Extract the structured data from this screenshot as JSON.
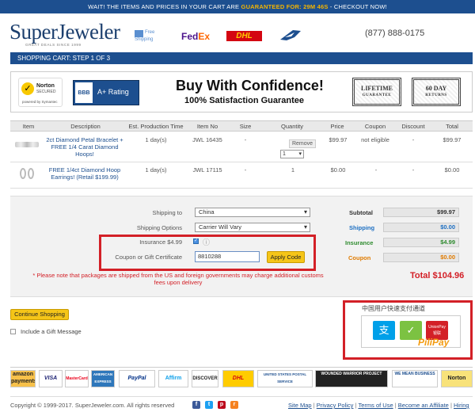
{
  "banner": {
    "prefix": "WAIT! THE ITEMS AND PRICES IN YOUR CART ARE ",
    "highlight": "GUARANTEED FOR: 29M 46S",
    "suffix": " - CHECKOUT NOW!"
  },
  "header": {
    "logo_part1": "Super",
    "logo_part2": "Jeweler",
    "logo_tagline": "GREAT DEALS SINCE 1999",
    "free_shipping": "Free Shipping",
    "fedex_fed": "Fed",
    "fedex_ex": "Ex",
    "dhl": "DHL",
    "phone": "(877) 888-0175"
  },
  "step_title": "SHOPPING CART: STEP 1 OF 3",
  "confidence": {
    "norton_name": "Norton",
    "norton_secured": "SECURED",
    "norton_powered": "powered by Symantec",
    "bbb_seal": "BBB",
    "bbb_rating": "A+ Rating",
    "title": "Buy With Confidence!",
    "subtitle": "100% Satisfaction Guarantee",
    "stamp1_line1": "LIFETIME",
    "stamp1_line2": "GUARANTEE",
    "stamp2_line1": "60 DAY",
    "stamp2_line2": "RETURNS"
  },
  "table": {
    "headers": [
      "Item",
      "Description",
      "Est. Production Time",
      "Item No",
      "Size",
      "Quantity",
      "Price",
      "Coupon",
      "Discount",
      "Total"
    ],
    "rows": [
      {
        "description": "2ct Diamond Petal Bracelet + FREE 1/4 Carat Diamond Hoops!",
        "production": "1 day(s)",
        "item_no": "JWL 16435",
        "size": "-",
        "remove": "Remove",
        "qty": "1",
        "price": "$99.97",
        "coupon": "not eligible",
        "discount": "-",
        "total": "$99.97"
      },
      {
        "description": "FREE 1/4ct Diamond Hoop Earrings! (Retail $199.99)",
        "production": "1 day(s)",
        "item_no": "JWL 17115",
        "size": "-",
        "qty": "1",
        "price": "$0.00",
        "coupon": "-",
        "discount": "-",
        "total": "$0.00"
      }
    ]
  },
  "shipping": {
    "ship_to_label": "Shipping to",
    "ship_to_value": "China",
    "options_label": "Shipping Options",
    "options_value": "Carrier Will Vary",
    "insurance_label": "Insurance $4.99",
    "coupon_label": "Coupon or Gift Certificate",
    "coupon_value": "8810288",
    "apply_label": "Apply Code",
    "note": "* Please note that packages are shipped from the US and foreign governments may charge additional customs fees upon delivery"
  },
  "summary": {
    "subtotal_label": "Subtotal",
    "subtotal_value": "$99.97",
    "shipping_label": "Shipping",
    "shipping_value": "$0.00",
    "insurance_label": "Insurance",
    "insurance_value": "$4.99",
    "coupon_label": "Coupon",
    "coupon_value": "$0.00",
    "total": "Total $104.96"
  },
  "actions": {
    "continue": "Continue Shopping",
    "gift": "Include a Gift Message"
  },
  "cnpay": {
    "title": "中国用户快速支付通道",
    "alipay": "支",
    "wechat": "✓",
    "unionpay": "UnionPay 银联",
    "pilipay": "PiliPay"
  },
  "badges": [
    "amazon payments",
    "VISA",
    "MasterCard",
    "AMERICAN EXPRESS",
    "PayPal",
    "Affirm",
    "DISCOVER",
    "DHL",
    "UNITED STATES POSTAL SERVICE",
    "WOUNDED WARRIOR PROJECT",
    "WE MEAN BUSINESS",
    "Norton"
  ],
  "footer": {
    "copyright": "Copyright © 1999-2017. SuperJeweler.com. All rights reserved",
    "links": [
      "Site Map",
      "Privacy Policy",
      "Terms of Use",
      "Become an Affiliate",
      "Hiring"
    ]
  },
  "colors": {
    "brand_blue": "#1d4f8f",
    "accent_yellow": "#f5c518",
    "highlight_red": "#d32027"
  }
}
